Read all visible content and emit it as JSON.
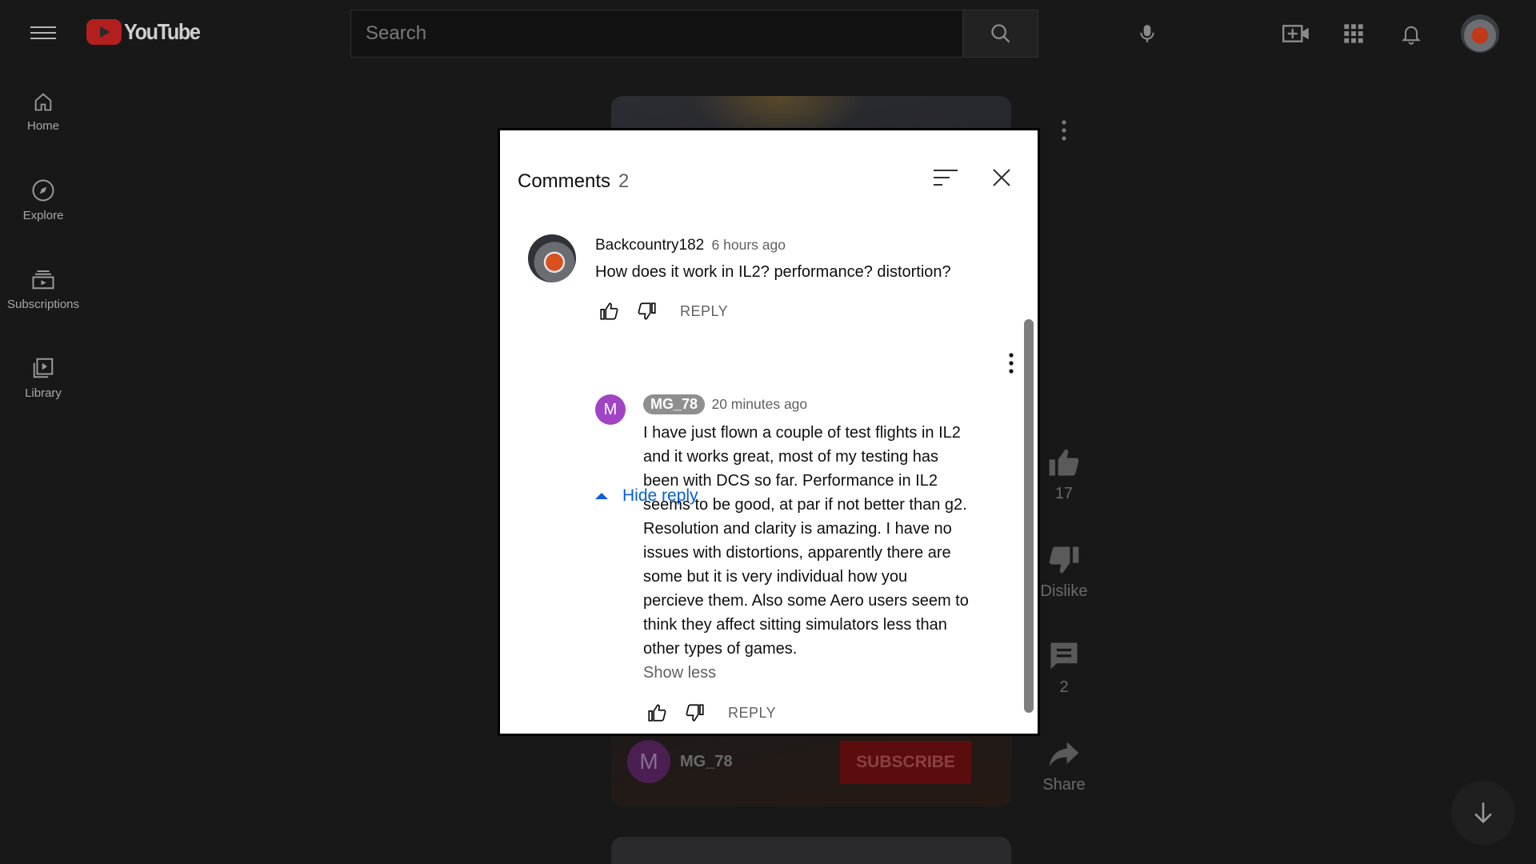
{
  "topbar": {
    "logo_text": "YouTube",
    "search_placeholder": "Search"
  },
  "sidebar": {
    "items": [
      {
        "label": "Home",
        "icon": "home-icon"
      },
      {
        "label": "Explore",
        "icon": "compass-icon"
      },
      {
        "label": "Subscriptions",
        "icon": "subscriptions-icon"
      },
      {
        "label": "Library",
        "icon": "library-icon"
      }
    ]
  },
  "background": {
    "channel_initial": "M",
    "channel_name": "MG_78",
    "subscribe_label": "SUBSCRIBE",
    "like_count": "17",
    "dislike_label": "Dislike",
    "comment_count": "2",
    "share_label": "Share"
  },
  "comments_dialog": {
    "title": "Comments",
    "count": "2",
    "comment": {
      "author": "Backcountry182",
      "time": "6 hours ago",
      "text": "How does it work in IL2? performance? distortion?",
      "reply_label": "REPLY",
      "toggle_label": "Hide reply"
    },
    "reply": {
      "avatar_initial": "M",
      "author": "MG_78",
      "time": "20 minutes ago",
      "text": "I have just flown a couple of test flights in IL2 and it works great, most of my testing has been with DCS so far. Performance in IL2 seems to be good, at par if not better than g2. Resolution and clarity is amazing. I have no issues with distortions, apparently there are some but it is very individual how you percieve them. Also some Aero users seem to think they affect sitting simulators less than other types of games.",
      "show_less_label": "Show less",
      "reply_label": "REPLY"
    }
  },
  "colors": {
    "background": "#181818",
    "link_blue": "#065fd4",
    "brand_red": "#b31f1f",
    "reply_avatar": "#a144c4"
  }
}
